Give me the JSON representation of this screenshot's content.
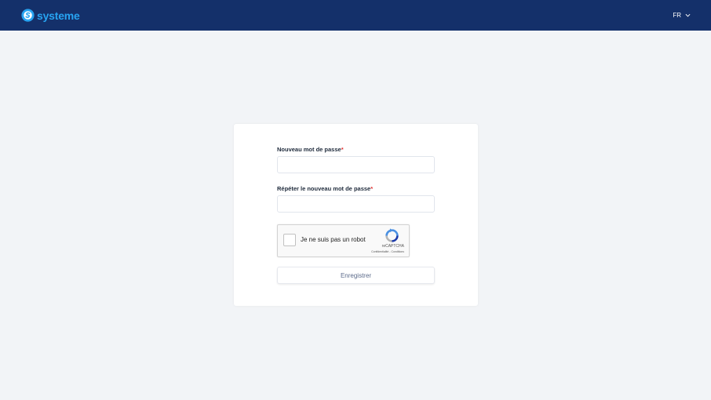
{
  "header": {
    "brand_name": "systeme",
    "brand_icon": "systeme-logo-icon",
    "language": "FR",
    "background_color": "#14306a",
    "brand_color": "#27a3f1"
  },
  "form": {
    "new_password_label": "Nouveau mot de passe",
    "new_password_value": "",
    "repeat_password_label": "Répéter le nouveau mot de passe",
    "repeat_password_value": "",
    "required_marker": "*",
    "submit_label": "Enregistrer"
  },
  "captcha": {
    "checkbox_label": "Je ne suis pas un robot",
    "brand": "reCAPTCHA",
    "privacy_link": "Confidentialité",
    "separator": " - ",
    "terms_link": "Conditions"
  }
}
